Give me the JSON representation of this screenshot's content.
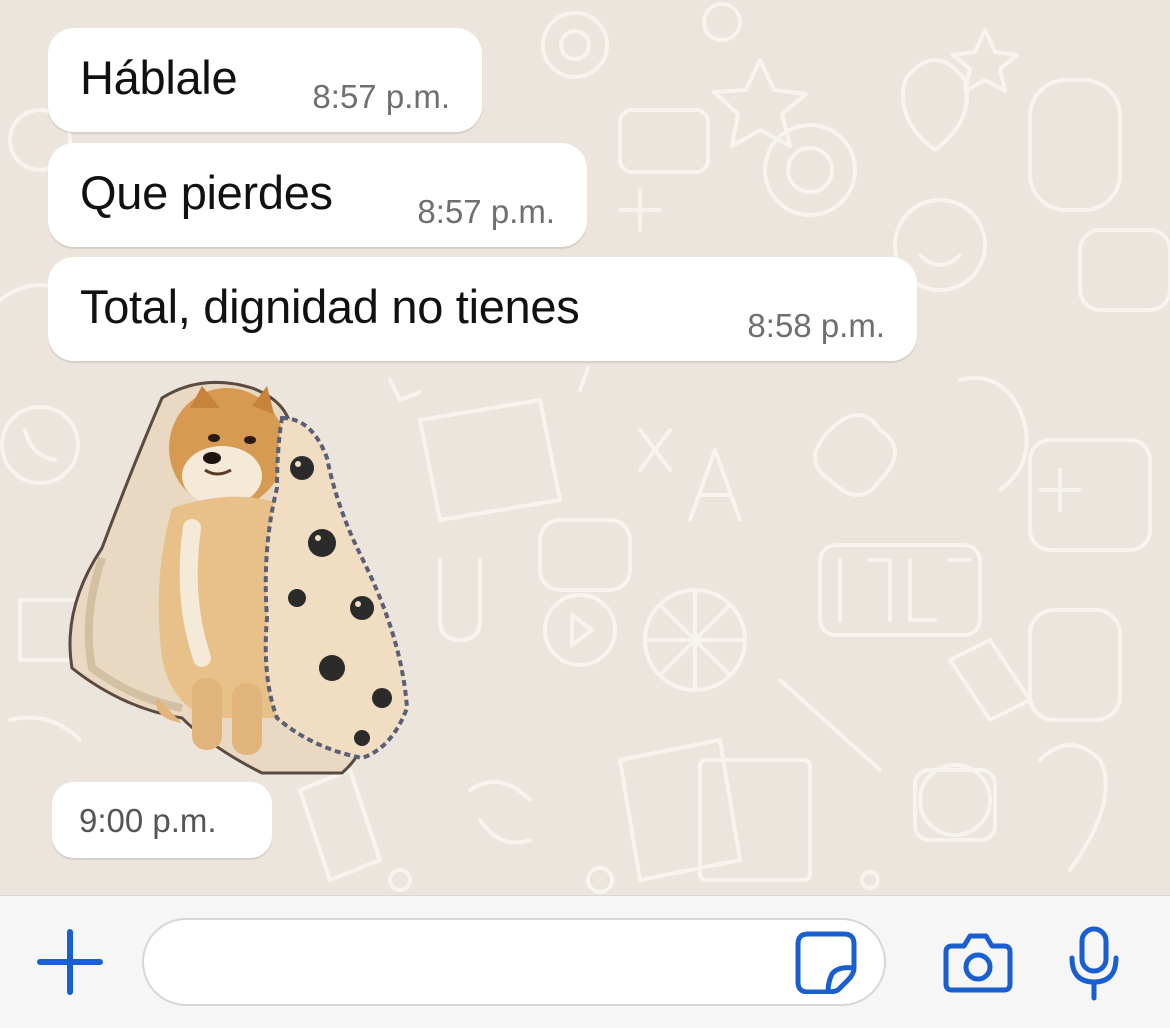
{
  "messages": [
    {
      "text": "Háblale",
      "time": "8:57 p.m."
    },
    {
      "text": "Que pierdes",
      "time": "8:57 p.m."
    },
    {
      "text": "Total, dignidad no tienes",
      "time": "8:58 p.m."
    }
  ],
  "sticker": {
    "time": "9:00 p.m.",
    "description": "dog-in-blanket-sticker"
  },
  "composer": {
    "placeholder": "",
    "value": ""
  },
  "icons": {
    "attach": "plus-icon",
    "sticker": "sticker-icon",
    "camera": "camera-icon",
    "mic": "microphone-icon"
  },
  "colors": {
    "accent": "#1a5fd0",
    "chat_background": "#ece5dd",
    "bubble": "#ffffff"
  }
}
